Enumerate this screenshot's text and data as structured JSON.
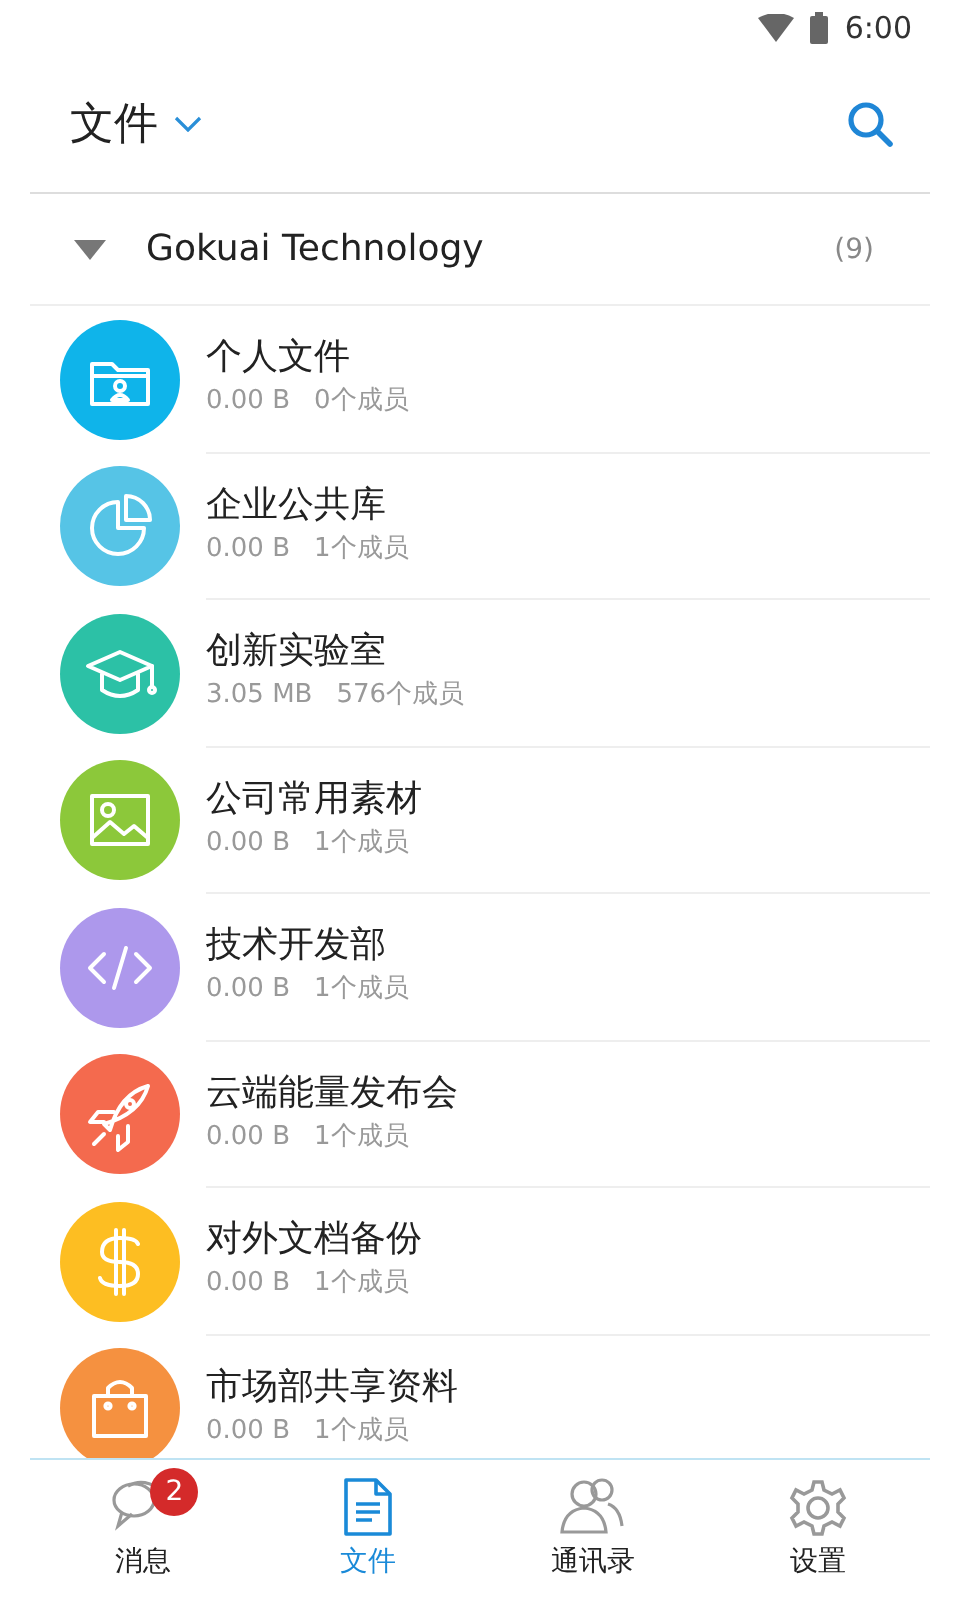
{
  "status_bar": {
    "time": "6:00"
  },
  "header": {
    "title": "文件"
  },
  "group": {
    "name": "Gokuai Technology",
    "count": "(9)",
    "expanded": true
  },
  "libraries": [
    {
      "kind": "folder",
      "color": "#0fb4ea",
      "name": "个人文件",
      "size": "0.00 B",
      "members": "0个成员"
    },
    {
      "kind": "pie",
      "color": "#56c4e6",
      "name": "企业公共库",
      "size": "0.00 B",
      "members": "1个成员"
    },
    {
      "kind": "cap",
      "color": "#2cc1a6",
      "name": "创新实验室",
      "size": "3.05 MB",
      "members": "576个成员"
    },
    {
      "kind": "image",
      "color": "#8cc83a",
      "name": "公司常用素材",
      "size": "0.00 B",
      "members": "1个成员"
    },
    {
      "kind": "code",
      "color": "#ad98ec",
      "name": "技术开发部",
      "size": "0.00 B",
      "members": "1个成员"
    },
    {
      "kind": "rocket",
      "color": "#f46a4e",
      "name": "云端能量发布会",
      "size": "0.00 B",
      "members": "1个成员"
    },
    {
      "kind": "dollar",
      "color": "#fdbe22",
      "name": "对外文档备份",
      "size": "0.00 B",
      "members": "1个成员"
    },
    {
      "kind": "bag",
      "color": "#f59140",
      "name": "市场部共享资料",
      "size": "0.00 B",
      "members": "1个成员"
    }
  ],
  "tabs": [
    {
      "kind": "messages",
      "label": "消息",
      "badge": "2",
      "selected": false
    },
    {
      "kind": "files",
      "label": "文件",
      "selected": true
    },
    {
      "kind": "contacts",
      "label": "通讯录",
      "selected": false
    },
    {
      "kind": "settings",
      "label": "设置",
      "selected": false
    }
  ]
}
